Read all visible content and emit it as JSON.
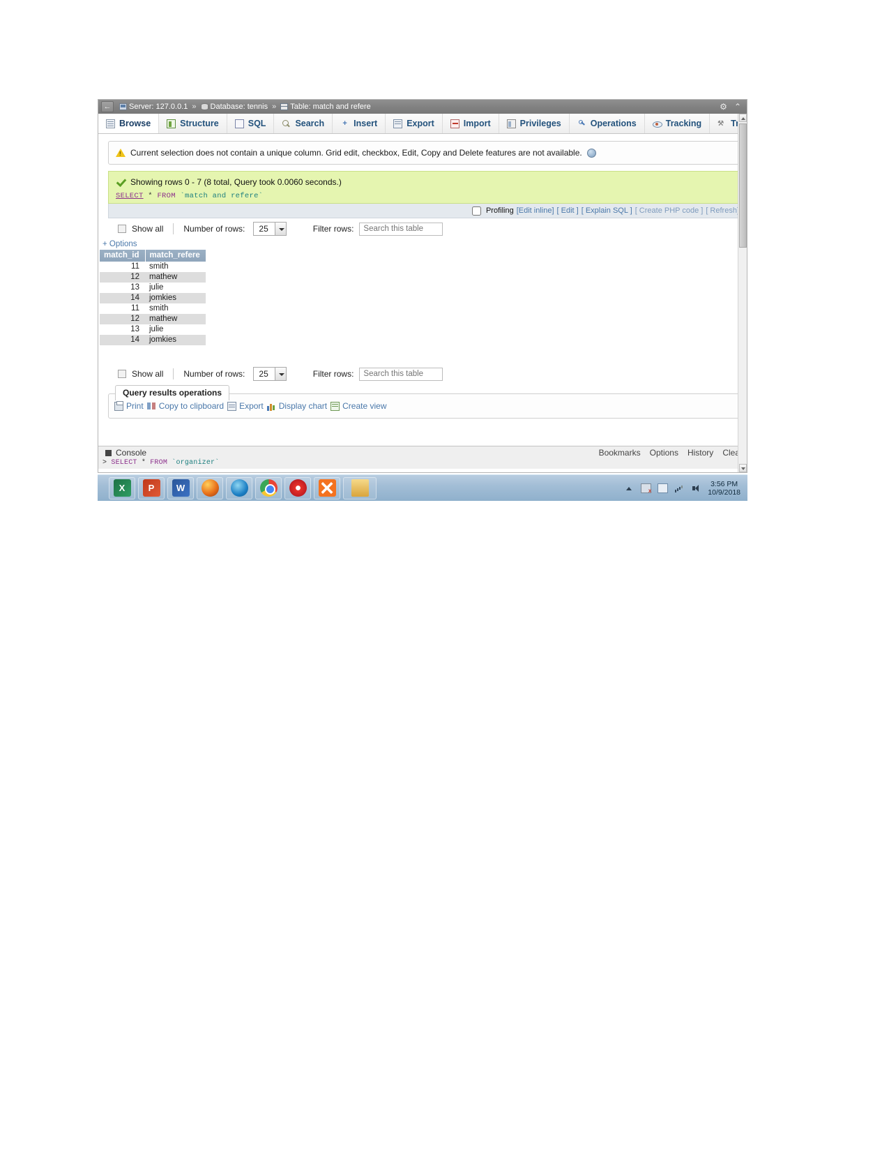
{
  "window": {
    "breadcrumb": {
      "back_label": "←",
      "server_icon": "server-icon",
      "server": "Server: 127.0.0.1",
      "sep1": "»",
      "database_icon": "database-icon",
      "database": "Database: tennis",
      "sep2": "»",
      "table_icon": "table-icon",
      "table": "Table: match and refere"
    },
    "controls": {
      "settings": "⚙",
      "collapse": "⌃"
    }
  },
  "nav_tabs": [
    {
      "label": "Browse",
      "icon": "browse-icon",
      "active": true
    },
    {
      "label": "Structure",
      "icon": "structure-icon",
      "active": false
    },
    {
      "label": "SQL",
      "icon": "sql-icon",
      "active": false
    },
    {
      "label": "Search",
      "icon": "search-icon",
      "active": false
    },
    {
      "label": "Insert",
      "icon": "insert-icon",
      "active": false
    },
    {
      "label": "Export",
      "icon": "export-icon",
      "active": false
    },
    {
      "label": "Import",
      "icon": "import-icon",
      "active": false
    },
    {
      "label": "Privileges",
      "icon": "privileges-icon",
      "active": false
    },
    {
      "label": "Operations",
      "icon": "operations-icon",
      "active": false
    },
    {
      "label": "Tracking",
      "icon": "tracking-icon",
      "active": false
    },
    {
      "label": "Triggers",
      "icon": "triggers-icon",
      "active": false
    }
  ],
  "notice": {
    "icon": "warning-icon",
    "text": "Current selection does not contain a unique column. Grid edit, checkbox, Edit, Copy and Delete features are not available.",
    "help_icon": "help-icon"
  },
  "result_info": {
    "icon": "success-check-icon",
    "text": "Showing rows 0 - 7 (8 total, Query took 0.0060 seconds.)",
    "sql": {
      "select": "SELECT",
      "star": "*",
      "from": "FROM",
      "table": "`match and refere`"
    }
  },
  "query_toolbar": {
    "profiling_label": "Profiling",
    "links": [
      "[Edit inline]",
      "[ Edit ]",
      "[ Explain SQL ]",
      "[ Create PHP code ]",
      "[ Refresh]"
    ]
  },
  "rowbar_top": {
    "show_all": "Show all",
    "number_of_rows_label": "Number of rows:",
    "number_of_rows_value": "25",
    "filter_label": "Filter rows:",
    "filter_placeholder": "Search this table"
  },
  "rowbar_bottom": {
    "show_all": "Show all",
    "number_of_rows_label": "Number of rows:",
    "number_of_rows_value": "25",
    "filter_label": "Filter rows:",
    "filter_placeholder": "Search this table"
  },
  "options_link": "+ Options",
  "results_table": {
    "columns": [
      "match_id",
      "match_refere"
    ],
    "rows": [
      [
        "11",
        "smith"
      ],
      [
        "12",
        "mathew"
      ],
      [
        "13",
        "julie"
      ],
      [
        "14",
        "jomkies"
      ],
      [
        "11",
        "smith"
      ],
      [
        "12",
        "mathew"
      ],
      [
        "13",
        "julie"
      ],
      [
        "14",
        "jomkies"
      ]
    ]
  },
  "query_results_operations": {
    "title": "Query results operations",
    "actions": [
      {
        "label": "Print",
        "icon": "print-icon"
      },
      {
        "label": "Copy to clipboard",
        "icon": "copy-icon"
      },
      {
        "label": "Export",
        "icon": "export-icon"
      },
      {
        "label": "Display chart",
        "icon": "chart-icon"
      },
      {
        "label": "Create view",
        "icon": "create-view-icon"
      }
    ]
  },
  "console": {
    "icon": "console-icon",
    "label": "Console",
    "links": [
      "Bookmarks",
      "Options",
      "History",
      "Clear"
    ],
    "last_query": {
      "prompt": ">",
      "select": "SELECT",
      "star": "*",
      "from": "FROM",
      "table": "`organizer`"
    }
  },
  "taskbar": {
    "apps": [
      {
        "name": "excel",
        "glyph": "X"
      },
      {
        "name": "powerpoint",
        "glyph": "P"
      },
      {
        "name": "word",
        "glyph": "W"
      },
      {
        "name": "firefox",
        "glyph": ""
      },
      {
        "name": "internet-explorer",
        "glyph": ""
      },
      {
        "name": "chrome",
        "glyph": ""
      },
      {
        "name": "opera",
        "glyph": ""
      },
      {
        "name": "xampp",
        "glyph": ""
      },
      {
        "name": "file-explorer",
        "glyph": ""
      }
    ],
    "tray": {
      "show_hidden_icons": "show-hidden-icons",
      "flag": "action-center-icon",
      "network": "network-icon",
      "signal": "signal-icon",
      "volume": "volume-icon",
      "time": "3:56 PM",
      "date": "10/9/2018"
    }
  },
  "colors": {
    "success_bg": "#e5f5b0",
    "link": "#4a78aa",
    "header_bg": "#9bb0c4",
    "taskbar": "#a3bed6"
  }
}
